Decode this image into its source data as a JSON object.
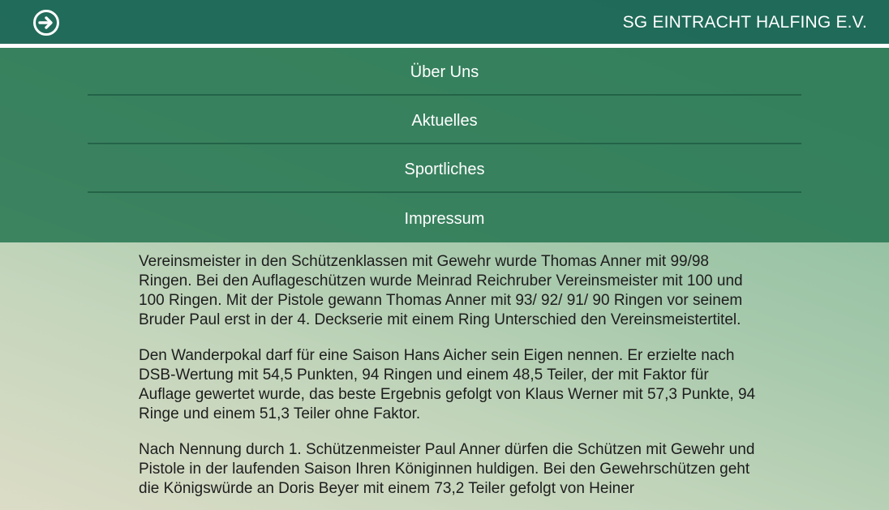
{
  "header": {
    "site_title": "SG EINTRACHT HALFING E.V.",
    "nav_toggle_icon": "arrow-right-circle-icon"
  },
  "menu": {
    "items": [
      {
        "label": "Über Uns"
      },
      {
        "label": "Aktuelles"
      },
      {
        "label": "Sportliches"
      },
      {
        "label": "Impressum"
      }
    ]
  },
  "article": {
    "paragraphs": [
      "Vereinsmeister in den Schützenklassen mit Gewehr wurde Thomas Anner mit 99/98 Ringen. Bei den Auflageschützen wurde Meinrad Reichruber Vereinsmeister mit 100 und 100 Ringen. Mit der Pistole gewann Thomas Anner mit 93/ 92/ 91/ 90 Ringen vor seinem Bruder Paul erst in der 4. Deckserie mit einem Ring Unterschied den Vereinsmeistertitel.",
      "Den Wanderpokal darf für eine Saison Hans Aicher sein Eigen nennen. Er erzielte nach DSB-Wertung mit 54,5 Punkten, 94 Ringen und einem 48,5 Teiler, der mit Faktor für Auflage gewertet wurde, das beste Ergebnis gefolgt von Klaus Werner mit 57,3 Punkte, 94 Ringe und einem 51,3 Teiler ohne Faktor.",
      "Nach Nennung durch 1. Schützenmeister Paul Anner dürfen die Schützen mit Gewehr und Pistole in der laufenden Saison Ihren Königinnen huldigen. Bei den Gewehrschützen geht die Königswürde an Doris Beyer mit einem 73,2 Teiler gefolgt von Heiner"
    ]
  },
  "colors": {
    "header_bg": "#186454",
    "menu_bg": "#267652",
    "text": "#1d1d1d"
  }
}
